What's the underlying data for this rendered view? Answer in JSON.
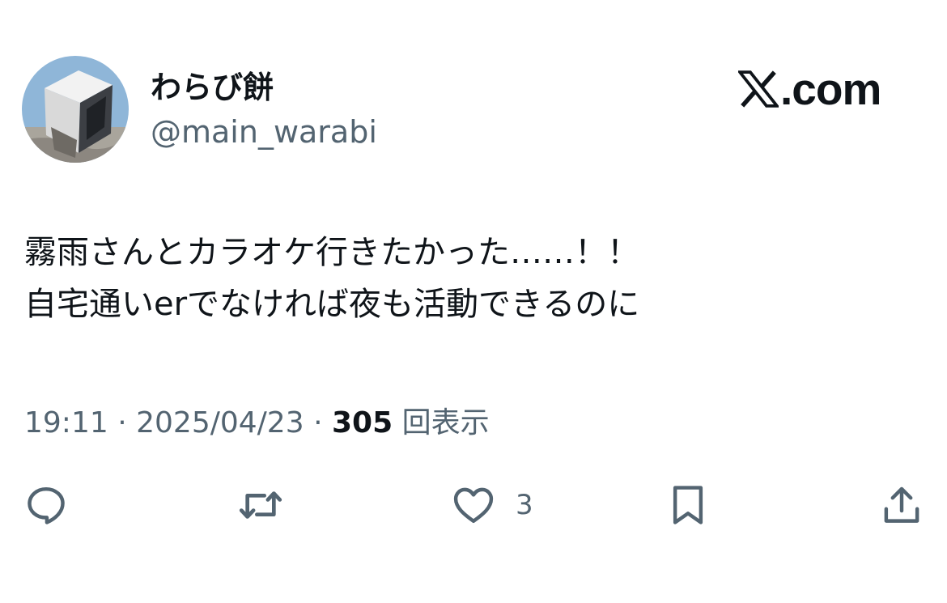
{
  "author": {
    "display_name": "わらび餅",
    "handle": "@main_warabi"
  },
  "brand": {
    "text": ".com",
    "icon": "x-logo-icon"
  },
  "post": {
    "lines": [
      "霧雨さんとカラオケ行きたかった……！！",
      "自宅通いerでなければ夜も活動できるのに"
    ]
  },
  "meta": {
    "time": "19:11",
    "separator": "·",
    "date": "2025/04/23",
    "views_count": "305",
    "views_label": "回表示"
  },
  "actions": {
    "reply": {
      "icon": "reply-icon"
    },
    "repost": {
      "icon": "repost-icon"
    },
    "like": {
      "icon": "heart-icon",
      "count": "3"
    },
    "bookmark": {
      "icon": "bookmark-icon"
    },
    "share": {
      "icon": "share-icon"
    }
  },
  "colors": {
    "text_primary": "#0f1419",
    "text_secondary": "#536471"
  }
}
